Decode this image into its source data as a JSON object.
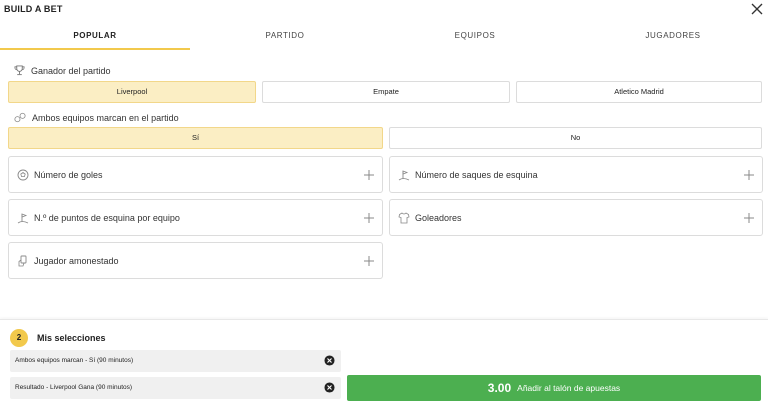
{
  "header": {
    "title": "BUILD A BET",
    "close_icon": "close-icon"
  },
  "tabs": [
    {
      "label": "POPULAR",
      "active": true
    },
    {
      "label": "PARTIDO",
      "active": false
    },
    {
      "label": "EQUIPOS",
      "active": false
    },
    {
      "label": "JUGADORES",
      "active": false
    }
  ],
  "match_winner": {
    "label": "Ganador del partido",
    "icon": "trophy-icon",
    "options": [
      {
        "label": "Liverpool",
        "selected": true
      },
      {
        "label": "Empate",
        "selected": false
      },
      {
        "label": "Atletico Madrid",
        "selected": false
      }
    ]
  },
  "both_score": {
    "label": "Ambos equipos marcan en el partido",
    "icon": "balls-icon",
    "options": [
      {
        "label": "Sí",
        "selected": true
      },
      {
        "label": "No",
        "selected": false
      }
    ]
  },
  "markets": [
    {
      "label": "Número de goles",
      "icon": "soccer-ball-icon"
    },
    {
      "label": "Número de saques de esquina",
      "icon": "corner-flag-icon"
    },
    {
      "label": "N.º de puntos de esquina por equipo",
      "icon": "corner-flag-icon"
    },
    {
      "label": "Goleadores",
      "icon": "shirt-icon"
    },
    {
      "label": "Jugador amonestado",
      "icon": "card-icon"
    }
  ],
  "selections": {
    "count": "2",
    "title": "Mis selecciones",
    "items": [
      {
        "label": "Ambos equipos marcan - Sí (90 minutos)"
      },
      {
        "label": "Resultado - Liverpool Gana (90 minutos)"
      }
    ]
  },
  "cta": {
    "odds": "3.00",
    "label": "Añadir al talón de apuestas"
  },
  "colors": {
    "accent": "#f2c94c",
    "selected_bg": "#fbeec4",
    "cta": "#4caf50"
  }
}
